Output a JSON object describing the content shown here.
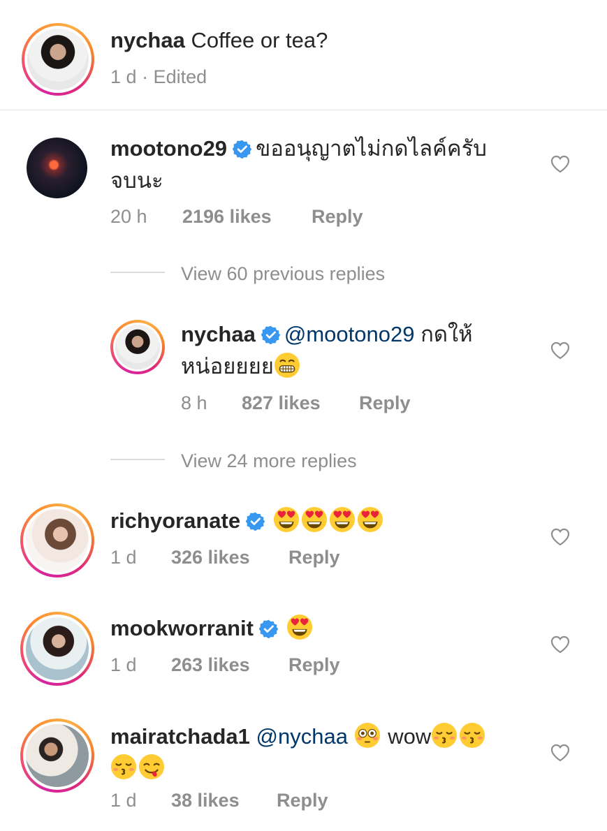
{
  "caption": {
    "username": "nychaa",
    "text": "Coffee or tea?",
    "time": "1 d",
    "edited": "· Edited"
  },
  "comments": [
    {
      "username": "mootono29",
      "verified": true,
      "text": "ขออนุญาตไม่กดไลค์ครับ",
      "text_line2": "จบนะ",
      "time": "20 h",
      "likes": "2196 likes",
      "reply": "Reply"
    },
    {
      "view_previous": "View 60 previous replies"
    },
    {
      "username": "nychaa",
      "verified": true,
      "mention": "@mootono29",
      "text": "กดให้",
      "text_line2": "หน่อยยยย",
      "time": "8 h",
      "likes": "827 likes",
      "reply": "Reply"
    },
    {
      "view_more": "View 24 more replies"
    },
    {
      "username": "richyoranate",
      "verified": true,
      "time": "1 d",
      "likes": "326 likes",
      "reply": "Reply"
    },
    {
      "username": "mookworranit",
      "verified": true,
      "time": "1 d",
      "likes": "263 likes",
      "reply": "Reply"
    },
    {
      "username": "mairatchada1",
      "mention": "@nychaa",
      "text": "wow",
      "time": "1 d",
      "likes": "38 likes",
      "reply": "Reply"
    }
  ],
  "icons": {
    "verified": "verified-badge-icon",
    "like": "heart-outline-icon",
    "emoji_heart_eyes": "heart-eyes-emoji",
    "emoji_grin": "grinning-emoji",
    "emoji_flushed": "flushed-emoji",
    "emoji_kiss": "kissing-closed-eyes-emoji",
    "emoji_yum": "yum-emoji"
  },
  "colors": {
    "verified": "#3897f0",
    "link": "#00376b",
    "meta": "#8e8e8e",
    "text": "#262626"
  }
}
